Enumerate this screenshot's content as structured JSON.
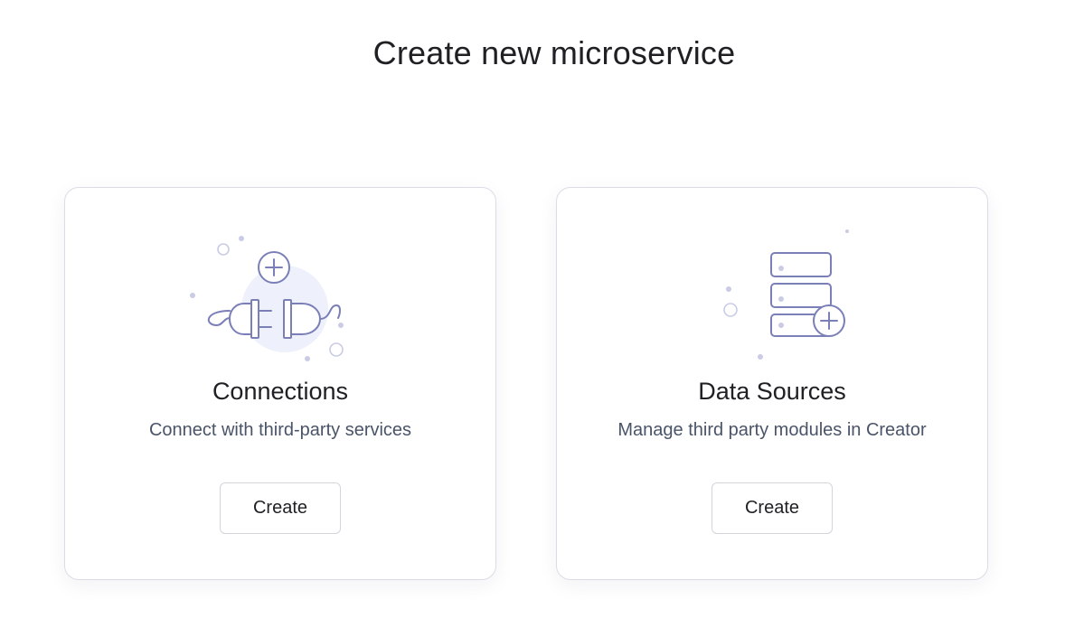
{
  "page": {
    "title": "Create new microservice"
  },
  "cards": [
    {
      "title": "Connections",
      "description": "Connect with third-party services",
      "button_label": "Create",
      "icon": "plug-connect-icon"
    },
    {
      "title": "Data Sources",
      "description": "Manage third party modules in Creator",
      "button_label": "Create",
      "icon": "database-add-icon"
    }
  ],
  "colors": {
    "illustration_stroke": "#7b7fb8",
    "illustration_fill": "#eef0fb",
    "card_border": "#dcdce6",
    "title_text": "#1f1f24",
    "description_text": "#4a5468"
  }
}
